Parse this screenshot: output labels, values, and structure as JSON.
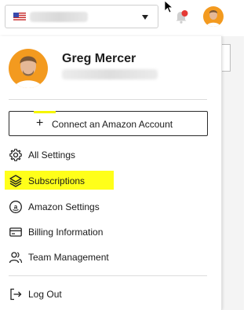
{
  "header": {
    "marketplace_flag": "us-flag-icon",
    "notifications_icon": "bell-icon",
    "notification_dot_color": "#e53935"
  },
  "profile": {
    "name": "Greg Mercer"
  },
  "connect_button": {
    "icon": "plus-icon",
    "label": "Connect an Amazon Account"
  },
  "menu": {
    "items": [
      {
        "icon": "gear-icon",
        "label": "All Settings"
      },
      {
        "icon": "layers-icon",
        "label": "Subscriptions"
      },
      {
        "icon": "amazon-icon",
        "label": "Amazon Settings"
      },
      {
        "icon": "credit-card-icon",
        "label": "Billing Information"
      },
      {
        "icon": "team-icon",
        "label": "Team Management"
      }
    ],
    "logout": {
      "icon": "logout-icon",
      "label": "Log Out"
    }
  },
  "colors": {
    "highlight": "#ffff1a",
    "text": "#1a1a1a",
    "divider": "#dcdcdc"
  }
}
